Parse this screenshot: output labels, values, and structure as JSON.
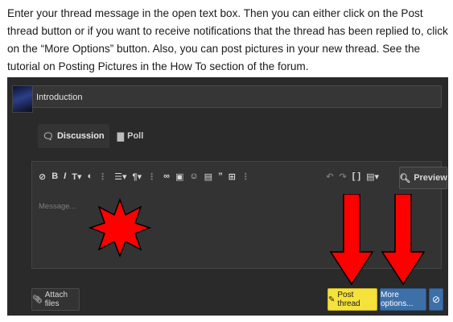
{
  "instructions": {
    "text": "Enter your thread message in the open text box. Then you can either click on the Post thread button or if you want to receive notifications that the thread has been replied to, click on the “More Options” button. Also, you can post pictures in your new thread. See the tutorial on Posting Pictures in the How To section of the forum."
  },
  "thread": {
    "title_value": "Introduction"
  },
  "tabs": [
    {
      "label": "Discussion",
      "icon": "chat-icon",
      "active": true
    },
    {
      "label": "Poll",
      "icon": "bar-chart-icon",
      "active": false
    }
  ],
  "editor": {
    "placeholder": "Message...",
    "toolbar_left": [
      "eraser-icon",
      "bold",
      "italic",
      "text-size-icon",
      "color-icon",
      "more-icon",
      "list-icon",
      "paragraph-icon",
      "link-icon",
      "image-icon",
      "smilie-icon",
      "media-icon",
      "quote-icon",
      "table-icon"
    ],
    "toolbar_right": [
      "undo-icon",
      "redo-icon",
      "bbcode-icon",
      "drafts-icon"
    ],
    "preview_label": "Preview"
  },
  "actions": {
    "attach_label": "Attach files",
    "post_label": "Post thread",
    "more_label": "More options...",
    "cancel_icon": "cancel-icon"
  },
  "colors": {
    "background": "#2a2a2a",
    "post_button": "#f5e23a",
    "more_button": "#3d6fa8",
    "annotation_red": "#ff0000"
  },
  "annotations": [
    "red-star",
    "red-arrow-to-post-thread",
    "red-arrow-to-more-options"
  ]
}
